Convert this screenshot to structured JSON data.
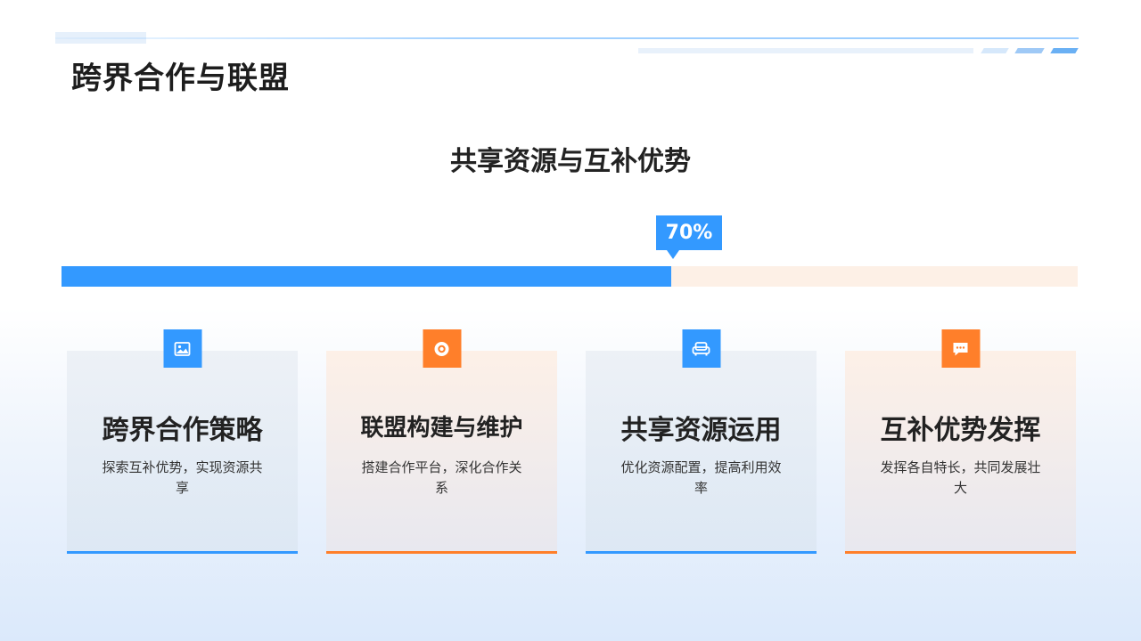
{
  "header": {
    "title": "跨界合作与联盟"
  },
  "section": {
    "subtitle": "共享资源与互补优势"
  },
  "progress": {
    "value": 0.6,
    "label": "70%",
    "fill_color": "#3399ff",
    "track_color": "#fdf0e6"
  },
  "colors": {
    "blue": "#3399ff",
    "orange": "#ff7f2a"
  },
  "cards": [
    {
      "icon": "image-icon",
      "title": "跨界合作策略",
      "desc": "探索互补优势，实现资源共享",
      "accent": "blue"
    },
    {
      "icon": "target-icon",
      "title": "联盟构建与维护",
      "desc": "搭建合作平台，深化合作关系",
      "accent": "orange"
    },
    {
      "icon": "sofa-icon",
      "title": "共享资源运用",
      "desc": "优化资源配置，提高利用效率",
      "accent": "blue"
    },
    {
      "icon": "chat-icon",
      "title": "互补优势发挥",
      "desc": "发挥各自特长，共同发展壮大",
      "accent": "orange"
    }
  ]
}
